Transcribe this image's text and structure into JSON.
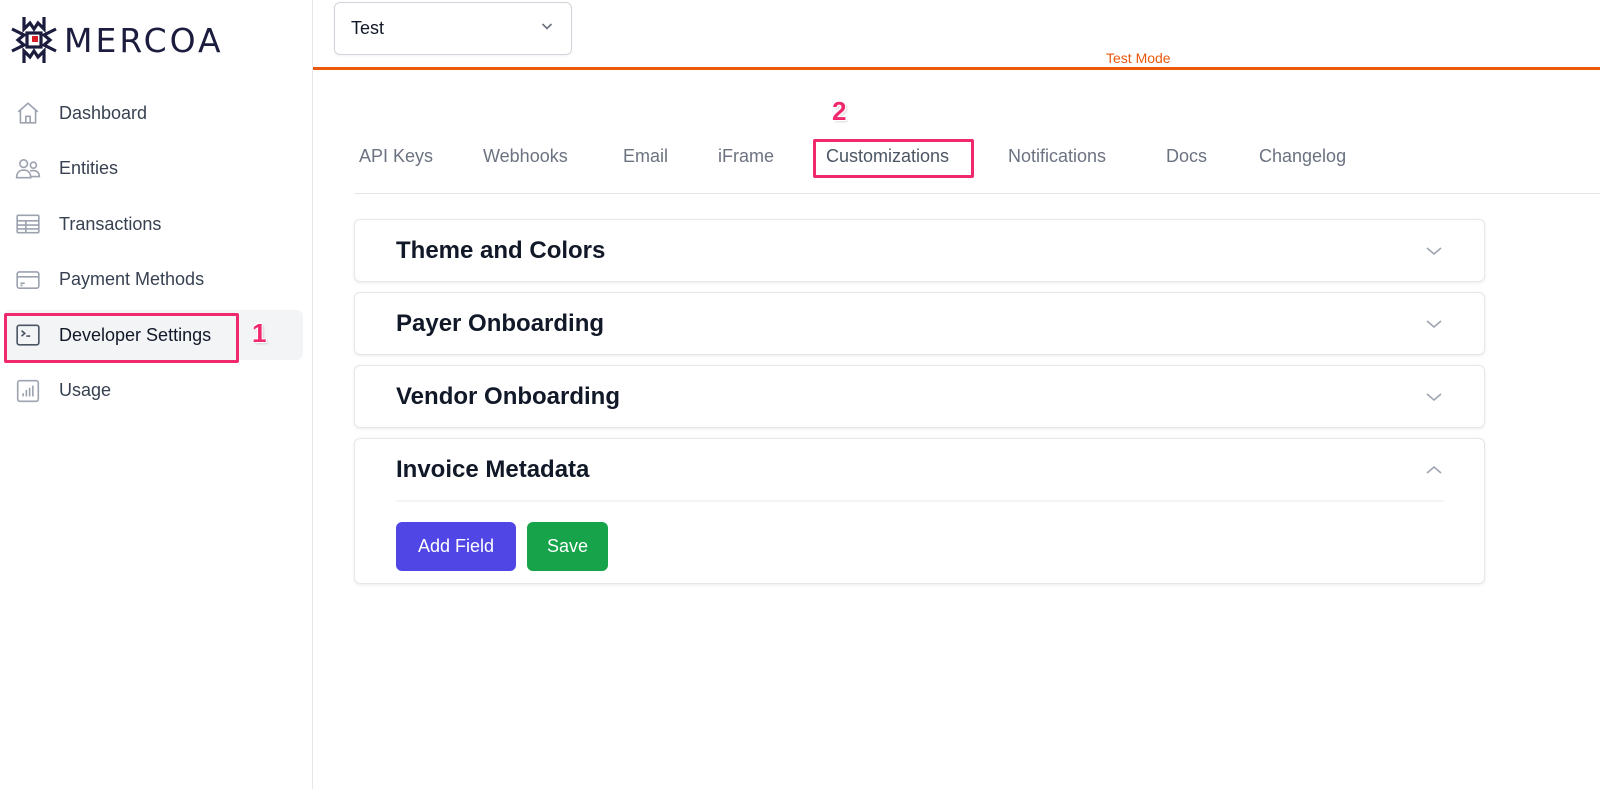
{
  "brand": {
    "name": "MERCOA",
    "accent_color": "#1b1c3e",
    "logo_dot_color": "#d91f26"
  },
  "sidebar": {
    "items": [
      {
        "label": "Dashboard",
        "icon": "home-icon",
        "active": false
      },
      {
        "label": "Entities",
        "icon": "users-icon",
        "active": false
      },
      {
        "label": "Transactions",
        "icon": "table-icon",
        "active": false
      },
      {
        "label": "Payment Methods",
        "icon": "credit-card-icon",
        "active": false
      },
      {
        "label": "Developer Settings",
        "icon": "terminal-icon",
        "active": true
      },
      {
        "label": "Usage",
        "icon": "chart-bar-icon",
        "active": false
      }
    ]
  },
  "header": {
    "environment_select": {
      "value": "Test"
    },
    "mode_label": "Test Mode",
    "mode_color": "#ea580c"
  },
  "tabs": [
    {
      "label": "API Keys",
      "active": false
    },
    {
      "label": "Webhooks",
      "active": false
    },
    {
      "label": "Email",
      "active": false
    },
    {
      "label": "iFrame",
      "active": false
    },
    {
      "label": "Customizations",
      "active": true
    },
    {
      "label": "Notifications",
      "active": false
    },
    {
      "label": "Docs",
      "active": false
    },
    {
      "label": "Changelog",
      "active": false
    }
  ],
  "sections": [
    {
      "title": "Theme and Colors",
      "expanded": false
    },
    {
      "title": "Payer Onboarding",
      "expanded": false
    },
    {
      "title": "Vendor Onboarding",
      "expanded": false
    },
    {
      "title": "Invoice Metadata",
      "expanded": true
    }
  ],
  "invoice_metadata": {
    "add_field_label": "Add Field",
    "save_label": "Save"
  },
  "annotations": {
    "step1": "1",
    "step2": "2",
    "color": "#f0286e"
  }
}
